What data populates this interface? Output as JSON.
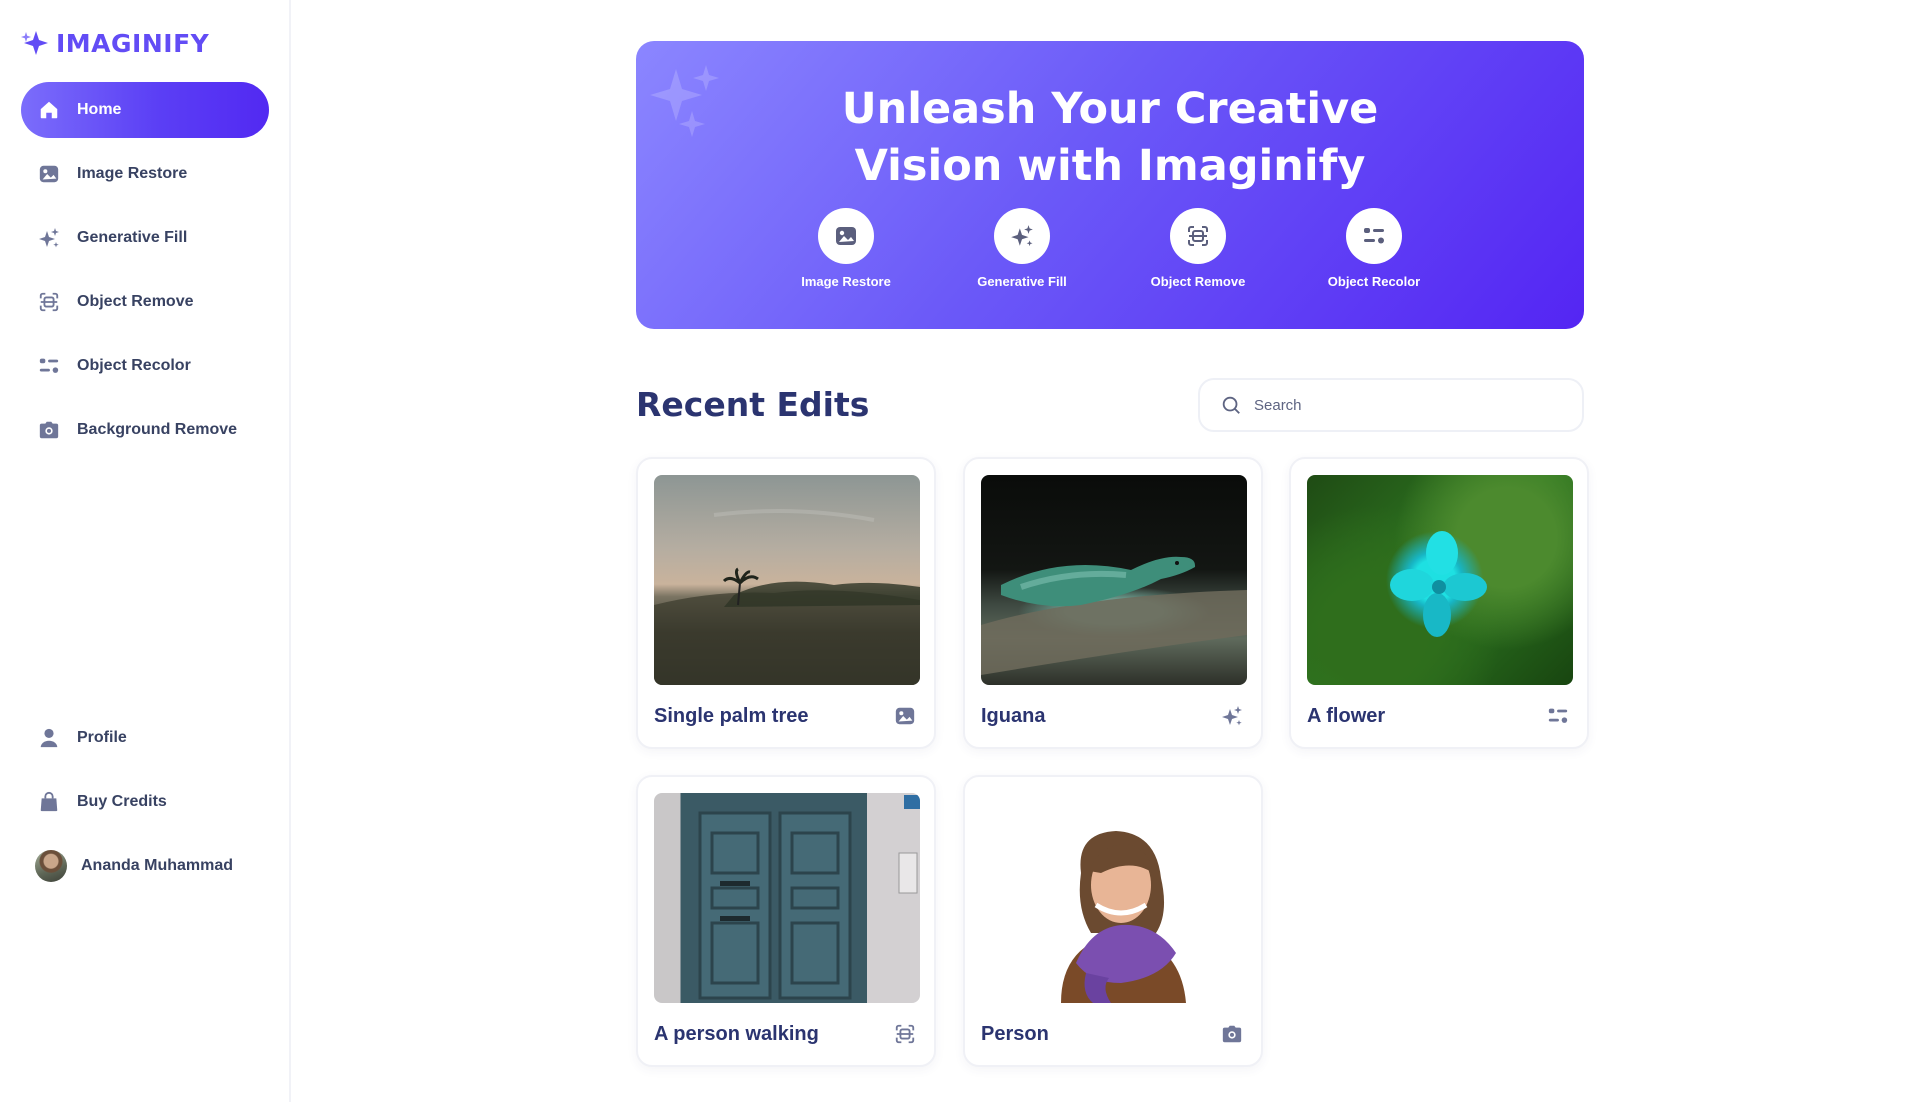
{
  "app": {
    "name": "IMAGINIFY",
    "brand_color": "#624cf5"
  },
  "sidebar": {
    "items": [
      {
        "label": "Home",
        "icon": "home-icon",
        "active": true
      },
      {
        "label": "Image Restore",
        "icon": "image-icon",
        "active": false
      },
      {
        "label": "Generative Fill",
        "icon": "sparkles-icon",
        "active": false
      },
      {
        "label": "Object Remove",
        "icon": "scan-icon",
        "active": false
      },
      {
        "label": "Object Recolor",
        "icon": "filter-icon",
        "active": false
      },
      {
        "label": "Background Remove",
        "icon": "camera-icon",
        "active": false
      }
    ],
    "bottom_items": [
      {
        "label": "Profile",
        "icon": "user-icon"
      },
      {
        "label": "Buy Credits",
        "icon": "bag-icon"
      }
    ],
    "user": {
      "name": "Ananda Muhammad"
    }
  },
  "hero": {
    "title_line1": "Unleash Your Creative",
    "title_line2": "Vision with Imaginify",
    "actions": [
      {
        "label": "Image Restore",
        "icon": "image-icon"
      },
      {
        "label": "Generative Fill",
        "icon": "sparkles-icon"
      },
      {
        "label": "Object Remove",
        "icon": "scan-icon"
      },
      {
        "label": "Object Recolor",
        "icon": "filter-icon"
      }
    ]
  },
  "recent": {
    "title": "Recent Edits",
    "search_placeholder": "Search",
    "cards": [
      {
        "title": "Single palm tree",
        "tool_icon": "image-icon"
      },
      {
        "title": "Iguana",
        "tool_icon": "sparkles-icon"
      },
      {
        "title": "A flower",
        "tool_icon": "filter-icon"
      },
      {
        "title": "A person walking",
        "tool_icon": "scan-icon"
      },
      {
        "title": "Person",
        "tool_icon": "camera-icon"
      }
    ]
  }
}
